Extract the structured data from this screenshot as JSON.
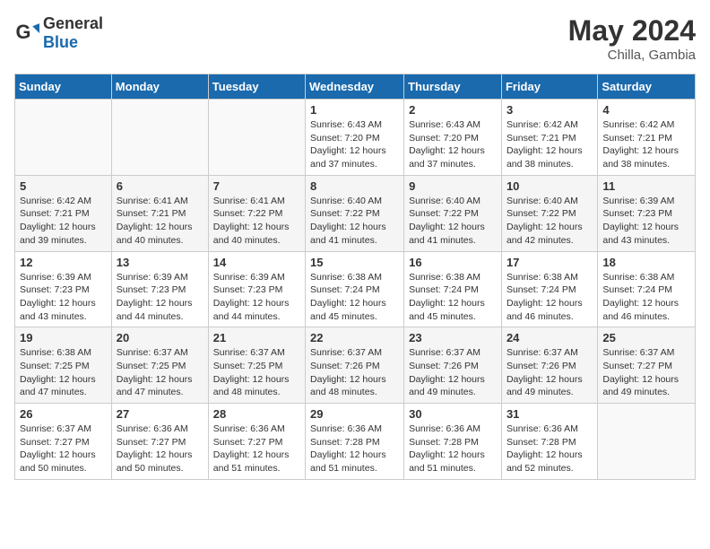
{
  "header": {
    "logo_general": "General",
    "logo_blue": "Blue",
    "month_year": "May 2024",
    "location": "Chilla, Gambia"
  },
  "days_of_week": [
    "Sunday",
    "Monday",
    "Tuesday",
    "Wednesday",
    "Thursday",
    "Friday",
    "Saturday"
  ],
  "weeks": [
    [
      {
        "day": "",
        "info": ""
      },
      {
        "day": "",
        "info": ""
      },
      {
        "day": "",
        "info": ""
      },
      {
        "day": "1",
        "info": "Sunrise: 6:43 AM\nSunset: 7:20 PM\nDaylight: 12 hours and 37 minutes."
      },
      {
        "day": "2",
        "info": "Sunrise: 6:43 AM\nSunset: 7:20 PM\nDaylight: 12 hours and 37 minutes."
      },
      {
        "day": "3",
        "info": "Sunrise: 6:42 AM\nSunset: 7:21 PM\nDaylight: 12 hours and 38 minutes."
      },
      {
        "day": "4",
        "info": "Sunrise: 6:42 AM\nSunset: 7:21 PM\nDaylight: 12 hours and 38 minutes."
      }
    ],
    [
      {
        "day": "5",
        "info": "Sunrise: 6:42 AM\nSunset: 7:21 PM\nDaylight: 12 hours and 39 minutes."
      },
      {
        "day": "6",
        "info": "Sunrise: 6:41 AM\nSunset: 7:21 PM\nDaylight: 12 hours and 40 minutes."
      },
      {
        "day": "7",
        "info": "Sunrise: 6:41 AM\nSunset: 7:22 PM\nDaylight: 12 hours and 40 minutes."
      },
      {
        "day": "8",
        "info": "Sunrise: 6:40 AM\nSunset: 7:22 PM\nDaylight: 12 hours and 41 minutes."
      },
      {
        "day": "9",
        "info": "Sunrise: 6:40 AM\nSunset: 7:22 PM\nDaylight: 12 hours and 41 minutes."
      },
      {
        "day": "10",
        "info": "Sunrise: 6:40 AM\nSunset: 7:22 PM\nDaylight: 12 hours and 42 minutes."
      },
      {
        "day": "11",
        "info": "Sunrise: 6:39 AM\nSunset: 7:23 PM\nDaylight: 12 hours and 43 minutes."
      }
    ],
    [
      {
        "day": "12",
        "info": "Sunrise: 6:39 AM\nSunset: 7:23 PM\nDaylight: 12 hours and 43 minutes."
      },
      {
        "day": "13",
        "info": "Sunrise: 6:39 AM\nSunset: 7:23 PM\nDaylight: 12 hours and 44 minutes."
      },
      {
        "day": "14",
        "info": "Sunrise: 6:39 AM\nSunset: 7:23 PM\nDaylight: 12 hours and 44 minutes."
      },
      {
        "day": "15",
        "info": "Sunrise: 6:38 AM\nSunset: 7:24 PM\nDaylight: 12 hours and 45 minutes."
      },
      {
        "day": "16",
        "info": "Sunrise: 6:38 AM\nSunset: 7:24 PM\nDaylight: 12 hours and 45 minutes."
      },
      {
        "day": "17",
        "info": "Sunrise: 6:38 AM\nSunset: 7:24 PM\nDaylight: 12 hours and 46 minutes."
      },
      {
        "day": "18",
        "info": "Sunrise: 6:38 AM\nSunset: 7:24 PM\nDaylight: 12 hours and 46 minutes."
      }
    ],
    [
      {
        "day": "19",
        "info": "Sunrise: 6:38 AM\nSunset: 7:25 PM\nDaylight: 12 hours and 47 minutes."
      },
      {
        "day": "20",
        "info": "Sunrise: 6:37 AM\nSunset: 7:25 PM\nDaylight: 12 hours and 47 minutes."
      },
      {
        "day": "21",
        "info": "Sunrise: 6:37 AM\nSunset: 7:25 PM\nDaylight: 12 hours and 48 minutes."
      },
      {
        "day": "22",
        "info": "Sunrise: 6:37 AM\nSunset: 7:26 PM\nDaylight: 12 hours and 48 minutes."
      },
      {
        "day": "23",
        "info": "Sunrise: 6:37 AM\nSunset: 7:26 PM\nDaylight: 12 hours and 49 minutes."
      },
      {
        "day": "24",
        "info": "Sunrise: 6:37 AM\nSunset: 7:26 PM\nDaylight: 12 hours and 49 minutes."
      },
      {
        "day": "25",
        "info": "Sunrise: 6:37 AM\nSunset: 7:27 PM\nDaylight: 12 hours and 49 minutes."
      }
    ],
    [
      {
        "day": "26",
        "info": "Sunrise: 6:37 AM\nSunset: 7:27 PM\nDaylight: 12 hours and 50 minutes."
      },
      {
        "day": "27",
        "info": "Sunrise: 6:36 AM\nSunset: 7:27 PM\nDaylight: 12 hours and 50 minutes."
      },
      {
        "day": "28",
        "info": "Sunrise: 6:36 AM\nSunset: 7:27 PM\nDaylight: 12 hours and 51 minutes."
      },
      {
        "day": "29",
        "info": "Sunrise: 6:36 AM\nSunset: 7:28 PM\nDaylight: 12 hours and 51 minutes."
      },
      {
        "day": "30",
        "info": "Sunrise: 6:36 AM\nSunset: 7:28 PM\nDaylight: 12 hours and 51 minutes."
      },
      {
        "day": "31",
        "info": "Sunrise: 6:36 AM\nSunset: 7:28 PM\nDaylight: 12 hours and 52 minutes."
      },
      {
        "day": "",
        "info": ""
      }
    ]
  ]
}
